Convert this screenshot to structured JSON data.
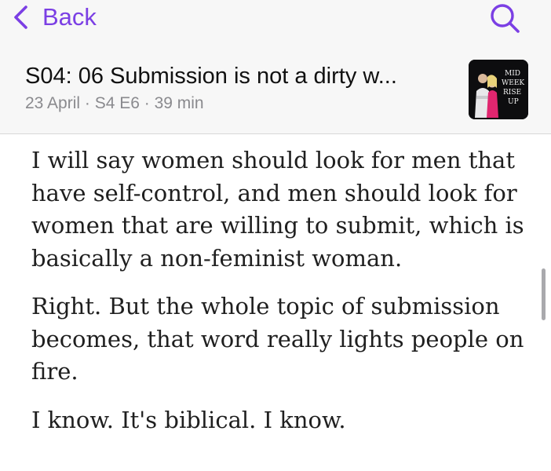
{
  "nav": {
    "back_label": "Back",
    "back_icon": "chevron-left-icon",
    "search_icon": "search-icon",
    "accent": "#7b3fe4"
  },
  "episode": {
    "title": "S04: 06 Submission is not a dirty w...",
    "meta": "23 April · S4 E6 · 39 min",
    "artwork_text": "MID WEEK RISE UP"
  },
  "transcript": {
    "paragraphs": [
      "I will say women should look for men that have self-control, and men should look for women that are willing to submit, which is basically a non-feminist woman.",
      "Right. But the whole topic of submission becomes, that word really lights people on fire.",
      "I know. It's biblical. I know."
    ]
  }
}
